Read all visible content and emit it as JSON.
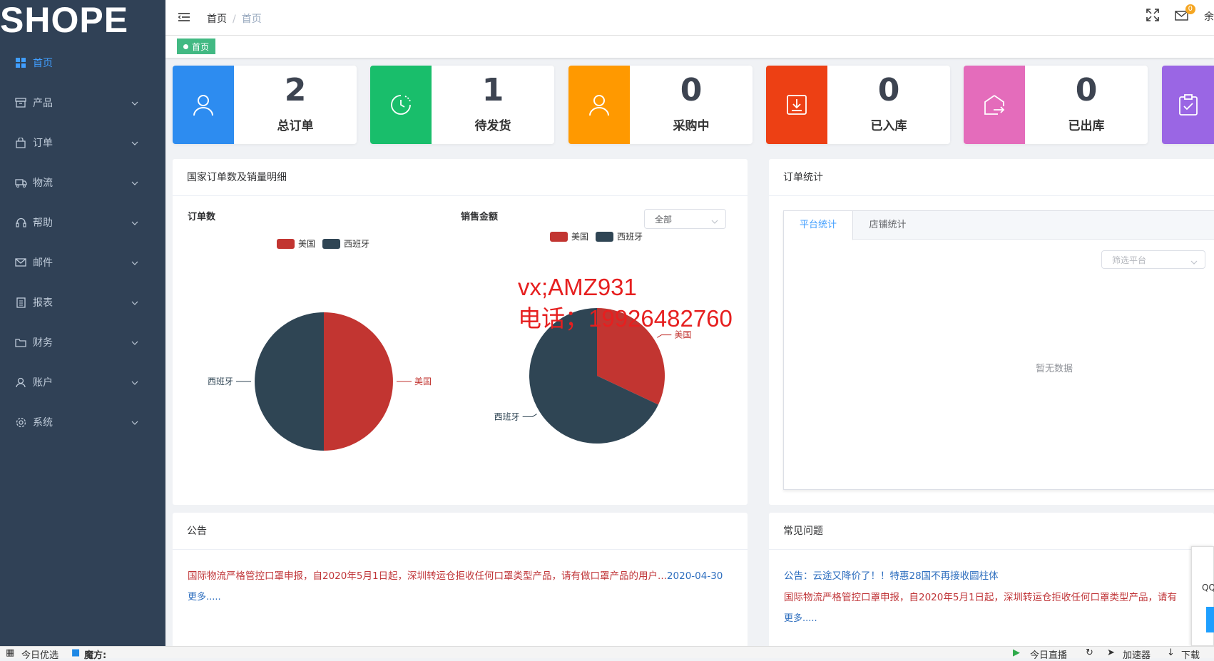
{
  "sidebar": {
    "logo": "SHOPE",
    "items": [
      {
        "label": "首页",
        "icon": "dashboard-icon"
      },
      {
        "label": "产品",
        "icon": "box-icon"
      },
      {
        "label": "订单",
        "icon": "bag-icon"
      },
      {
        "label": "物流",
        "icon": "truck-icon"
      },
      {
        "label": "帮助",
        "icon": "headset-icon"
      },
      {
        "label": "邮件",
        "icon": "mail-icon"
      },
      {
        "label": "报表",
        "icon": "report-icon"
      },
      {
        "label": "财务",
        "icon": "folder-icon"
      },
      {
        "label": "账户",
        "icon": "user-icon"
      },
      {
        "label": "系统",
        "icon": "gear-icon"
      }
    ]
  },
  "header": {
    "breadcrumb_home": "首页",
    "breadcrumb_current": "首页",
    "mail_badge": "0",
    "user_initial": "余"
  },
  "tags": {
    "active_tag": "首页"
  },
  "stats": [
    {
      "value": "2",
      "label": "总订单",
      "color": "#2d8cf0",
      "icon": "user-icon"
    },
    {
      "value": "1",
      "label": "待发货",
      "color": "#19be6b",
      "icon": "clock-icon"
    },
    {
      "value": "0",
      "label": "采购中",
      "color": "#ff9900",
      "icon": "user-icon"
    },
    {
      "value": "0",
      "label": "已入库",
      "color": "#ed4014",
      "icon": "download-icon"
    },
    {
      "value": "0",
      "label": "已出库",
      "color": "#e46cbb",
      "icon": "export-icon"
    },
    {
      "value": "",
      "label": "",
      "color": "#9a66e4",
      "icon": "clipboard-check-icon"
    }
  ],
  "country_panel": {
    "title": "国家订单数及销量明细",
    "orders_title": "订单数",
    "sales_title": "销售金额",
    "filter_value": "全部"
  },
  "order_stats_panel": {
    "title": "订单统计",
    "tabs": [
      "平台统计",
      "店铺统计"
    ],
    "platform_placeholder": "筛选平台",
    "empty_text": "暂无数据"
  },
  "notice_panel": {
    "title": "公告",
    "text": "国际物流严格管控口罩申报，自2020年5月1日起，深圳转运仓拒收任何口罩类型产品，请有做口罩产品的用户...",
    "date": "2020-04-30",
    "more": "更多....."
  },
  "faq_panel": {
    "title": "常见问题",
    "line1": "公告：云途又降价了！！特惠28国不再接收圆柱体",
    "line2": "国际物流严格管控口罩申报，自2020年5月1日起，深圳转运仓拒收任何口罩类型产品，请有",
    "more": "更多....."
  },
  "watermark": {
    "line1": "vx;AMZ931",
    "line2": "电话；19926482760"
  },
  "qq_widget": {
    "label": "QQ"
  },
  "taskbar": {
    "left1": "今日优选",
    "left2": "魔方:",
    "right1": "今日直播",
    "right2": "加速器",
    "right3": "下载"
  },
  "chart_data": [
    {
      "type": "pie",
      "title": "订单数",
      "legend": [
        "美国",
        "西班牙"
      ],
      "categories": [
        "美国",
        "西班牙"
      ],
      "values": [
        1,
        1
      ],
      "colors": [
        "#c23531",
        "#2f4554"
      ]
    },
    {
      "type": "pie",
      "title": "销售金额",
      "legend": [
        "美国",
        "西班牙"
      ],
      "categories": [
        "美国",
        "西班牙"
      ],
      "values": [
        32,
        68
      ],
      "colors": [
        "#c23531",
        "#2f4554"
      ]
    }
  ]
}
